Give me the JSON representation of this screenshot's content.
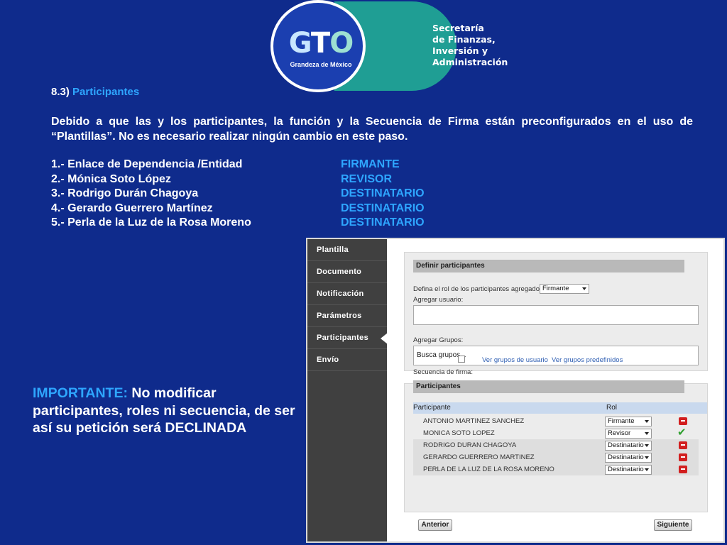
{
  "logo": {
    "gto_letters": [
      "G",
      "T",
      "O"
    ],
    "tagline": "Grandeza de México",
    "secretaria_lines": [
      "Secretaría",
      "de Finanzas,",
      "Inversión y",
      "Administración"
    ]
  },
  "heading": {
    "number": "8.3)",
    "title": "Participantes"
  },
  "paragraph": "Debido a que las y los participantes, la función y la Secuencia de Firma están preconfigurados en el uso de “Plantillas”. No es necesario realizar ningún cambio en este paso.",
  "participants": [
    {
      "name": "1.- Enlace de Dependencia /Entidad",
      "role": "FIRMANTE"
    },
    {
      "name": "2.- Mónica Soto López",
      "role": "REVISOR"
    },
    {
      "name": "3.- Rodrigo Durán Chagoya",
      "role": "DESTINATARIO"
    },
    {
      "name": "4.- Gerardo Guerrero Martínez",
      "role": "DESTINATARIO"
    },
    {
      "name": "5.- Perla de la Luz de la Rosa Moreno",
      "role": "DESTINATARIO"
    }
  ],
  "important": {
    "label": "IMPORTANTE:",
    "text": " No modificar participantes, roles ni secuencia, de ser así su petición será DECLINADA"
  },
  "app": {
    "sidebar": [
      "Plantilla",
      "Documento",
      "Notificación",
      "Parámetros",
      "Participantes",
      "Envío"
    ],
    "active_index": 4,
    "define": {
      "title": "Definir participantes",
      "role_label": "Defina el rol de los participantes agregados:",
      "role_value": "Firmante",
      "user_label": "Agregar usuario:",
      "user_value": "",
      "groups_label": "Agregar Grupos:",
      "groups_placeholder": "Busca grupos...",
      "sequence_label": "Secuencia de firma:",
      "link_user_groups": "Ver grupos de usuario",
      "link_predef_groups": "Ver grupos predefinidos"
    },
    "table": {
      "title": "Participantes",
      "col_participant": "Participante",
      "col_role": "Rol",
      "rows": [
        {
          "name": "ANTONIO MARTINEZ SANCHEZ",
          "role": "Firmante",
          "status": "delete"
        },
        {
          "name": "MONICA SOTO LOPEZ",
          "role": "Revisor",
          "status": "ok"
        },
        {
          "name": "RODRIGO DURAN CHAGOYA",
          "role": "Destinatario",
          "status": "delete"
        },
        {
          "name": "GERARDO GUERRERO MARTINEZ",
          "role": "Destinatario",
          "status": "delete"
        },
        {
          "name": "PERLA DE LA LUZ DE LA ROSA MORENO",
          "role": "Destinatario",
          "status": "delete"
        }
      ]
    },
    "buttons": {
      "prev": "Anterior",
      "next": "Siguiente"
    }
  },
  "colors": {
    "background": "#0f2b8c",
    "highlight": "#2ea6ff",
    "logo_teal": "#1f9e94",
    "sidebar": "#404040"
  }
}
